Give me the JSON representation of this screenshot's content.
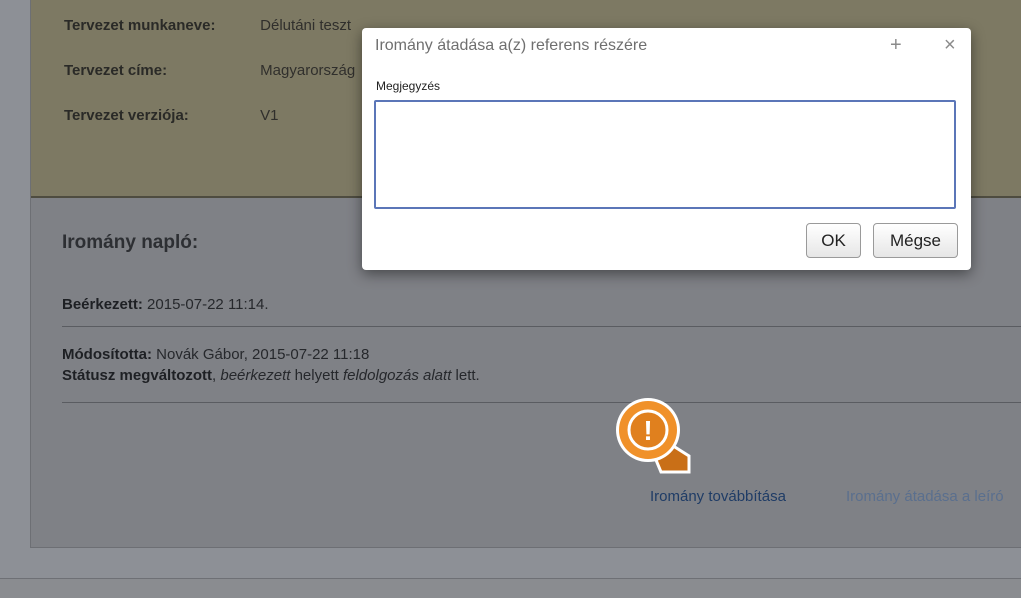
{
  "project": {
    "fields": [
      {
        "label": "Tervezet munkaneve:",
        "value": "Délutáni teszt"
      },
      {
        "label": "Tervezet címe:",
        "value": "Magyarország"
      },
      {
        "label": "Tervezet verziója:",
        "value": "V1"
      }
    ]
  },
  "log": {
    "title": "Iromány napló:",
    "received_label": "Beérkezett:",
    "received_value": "2015-07-22 11:14.",
    "modified_label": "Módosította:",
    "modified_value": "Novák Gábor, 2015-07-22 11:18",
    "status_changed_label": "Státusz megváltozott",
    "status_comma": ",",
    "status_from": "beérkezett",
    "status_instead": "helyett",
    "status_to": "feldolgozás alatt",
    "status_end": "lett."
  },
  "actions": {
    "forward_label": "Iromány továbbítása",
    "handover_label": "Iromány átadása a leíró"
  },
  "alert": {
    "symbol": "!",
    "color": "#f0912a"
  },
  "dialog": {
    "title": "Iromány átadása a(z) referens részére",
    "plus_symbol": "+",
    "close_symbol": "×",
    "comment_label": "Megjegyzés",
    "comment_value": "",
    "ok_label": "OK",
    "cancel_label": "Mégse"
  }
}
